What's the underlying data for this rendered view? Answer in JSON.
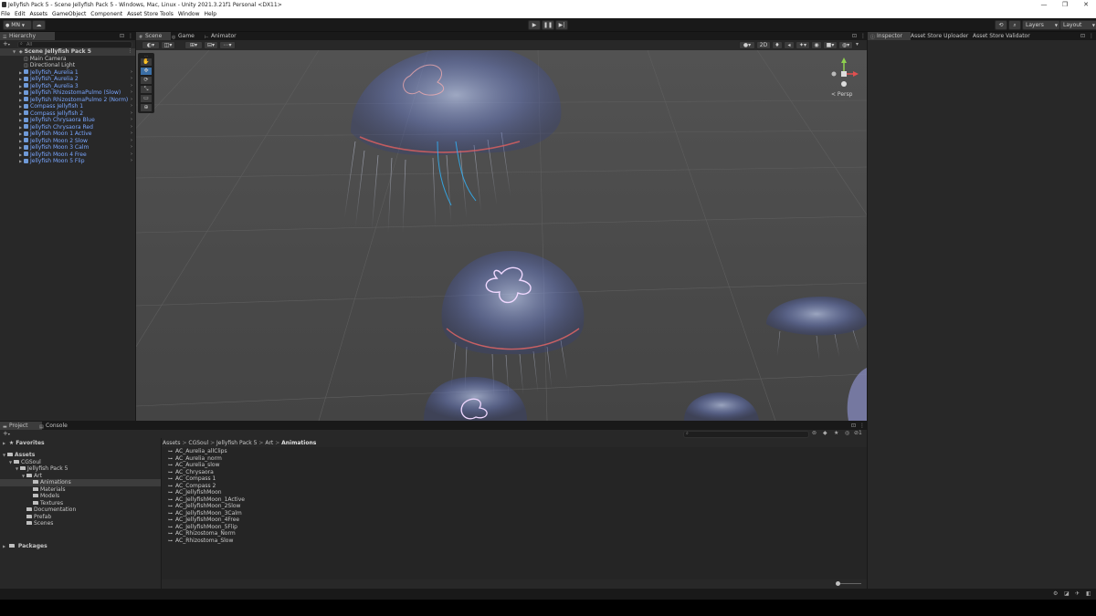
{
  "window": {
    "title": "Jellyfish Pack 5 - Scene Jellyfish Pack 5 - Windows, Mac, Linux - Unity 2021.3.21f1 Personal <DX11>",
    "controls": [
      "—",
      "❐",
      "✕"
    ]
  },
  "menu": [
    "File",
    "Edit",
    "Assets",
    "GameObject",
    "Component",
    "Asset Store Tools",
    "Window",
    "Help"
  ],
  "toolbar": {
    "account": "MN",
    "layers_label": "Layers",
    "layout_label": "Layout"
  },
  "hierarchy": {
    "tab": "Hierarchy",
    "search_placeholder": "All",
    "scene_name": "Scene Jellyfish Pack 5",
    "items": [
      {
        "label": "Main Camera",
        "prefab": false
      },
      {
        "label": "Directional Light",
        "prefab": false
      },
      {
        "label": "Jellyfish_Aurelia 1",
        "prefab": true
      },
      {
        "label": "Jellyfish_Aurelia 2",
        "prefab": true
      },
      {
        "label": "Jellyfish_Aurelia 3",
        "prefab": true
      },
      {
        "label": "Jellyfish RhizostomaPulmo (Slow)",
        "prefab": true
      },
      {
        "label": "Jellyfish RhizostomaPulmo 2 (Norm)",
        "prefab": true
      },
      {
        "label": "Compass Jellyfish 1",
        "prefab": true
      },
      {
        "label": "Compass Jellyfish 2",
        "prefab": true
      },
      {
        "label": "Jellyfish Chrysaora Blue",
        "prefab": true
      },
      {
        "label": "Jellyfish Chrysaora Red",
        "prefab": true
      },
      {
        "label": "Jellyfish Moon 1 Active",
        "prefab": true
      },
      {
        "label": "Jellyfish Moon 2 Slow",
        "prefab": true
      },
      {
        "label": "Jellyfish Moon 3 Calm",
        "prefab": true
      },
      {
        "label": "Jellyfish Moon 4 Free",
        "prefab": true
      },
      {
        "label": "Jellyfish Moon 5 Flip",
        "prefab": true
      }
    ]
  },
  "scene_tabs": [
    "Scene",
    "Game",
    "Animator"
  ],
  "scene_toolbar": {
    "mode_2d": "2D"
  },
  "gizmo": {
    "projection": "< Persp"
  },
  "inspector_tabs": [
    "Inspector",
    "Asset Store Uploader",
    "Asset Store Validator"
  ],
  "project": {
    "tabs": [
      "Project",
      "Console"
    ],
    "favorites": "Favorites",
    "tree": [
      {
        "label": "Assets",
        "depth": 0,
        "bold": true
      },
      {
        "label": "CGSoul",
        "depth": 1
      },
      {
        "label": "Jellyfish Pack 5",
        "depth": 2
      },
      {
        "label": "Art",
        "depth": 3
      },
      {
        "label": "Animations",
        "depth": 4,
        "selected": true
      },
      {
        "label": "Materials",
        "depth": 4
      },
      {
        "label": "Models",
        "depth": 4
      },
      {
        "label": "Textures",
        "depth": 4
      },
      {
        "label": "Documentation",
        "depth": 3
      },
      {
        "label": "Prefab",
        "depth": 3
      },
      {
        "label": "Scenes",
        "depth": 3
      }
    ],
    "packages": "Packages",
    "breadcrumb": [
      "Assets",
      "CGSoul",
      "Jellyfish Pack 5",
      "Art",
      "Animations"
    ],
    "hidden_count": "1",
    "files": [
      "AC_Aurelia_allClips",
      "AC_Aurelia_norm",
      "AC_Aurelia_slow",
      "AC_Chrysaora",
      "AC_Compass 1",
      "AC_Compass 2",
      "AC_JellyfishMoon",
      "AC_JellyfishMoon_1Active",
      "AC_JellyfishMoon_2Slow",
      "AC_JellyfishMoon_3Calm",
      "AC_JellyfishMoon_4Free",
      "AC_JellyfishMoon_5Flip",
      "AC_Rhizostoma_Norm",
      "AC_Rhizostoma_Slow"
    ]
  },
  "colors": {
    "accent_blue": "#79a6ff",
    "selection": "#2c5d87",
    "scene_bg": "#4a4a4a"
  }
}
